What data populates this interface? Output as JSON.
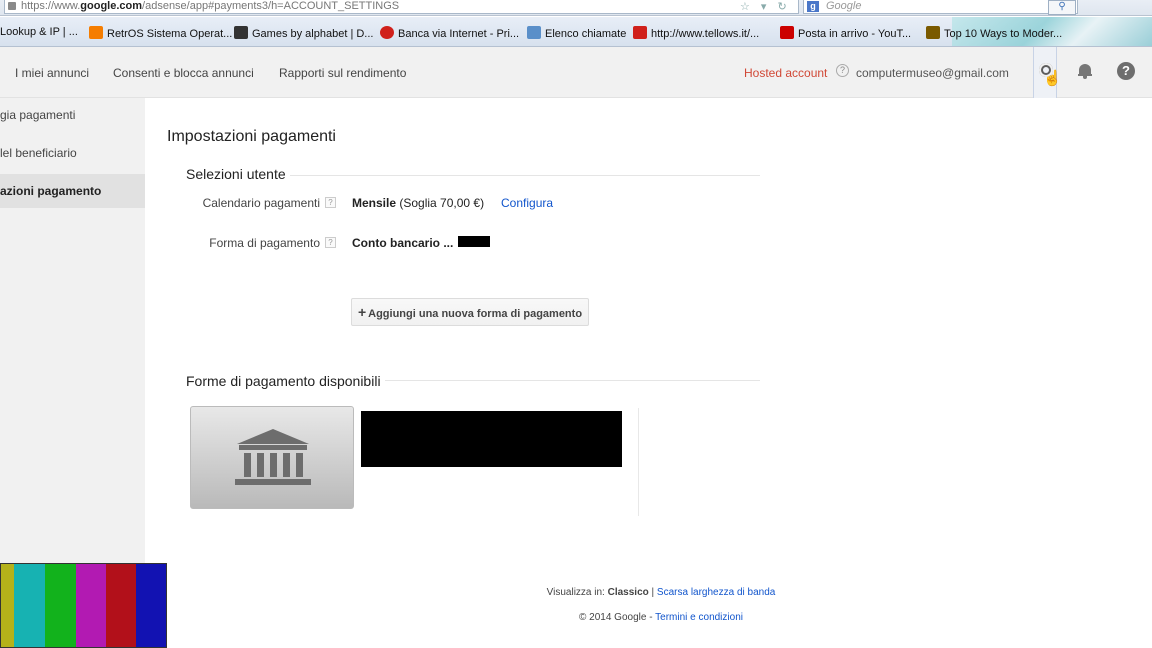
{
  "browser": {
    "url_prefix": "https://www.",
    "url_domain": "google.com",
    "url_path": "/adsense/app#payments3/h=ACCOUNT_SETTINGS",
    "search_placeholder": "Google",
    "bookmarks": [
      {
        "label": "Lookup & IP | ...",
        "color": "#888888"
      },
      {
        "label": "RetrOS Sistema Operat...",
        "color": "#f57d00"
      },
      {
        "label": "Games by alphabet | D...",
        "color": "#333333"
      },
      {
        "label": "Banca via Internet - Pri...",
        "color": "#d0201b"
      },
      {
        "label": "Elenco chiamate",
        "color": "#5a8fc9"
      },
      {
        "label": "http://www.tellows.it/...",
        "color": "#d0201b"
      },
      {
        "label": "Posta in arrivo - YouT...",
        "color": "#cc0000"
      },
      {
        "label": "Top 10 Ways to Moder...",
        "color": "#7a5a00"
      }
    ]
  },
  "header": {
    "nav": [
      "I miei annunci",
      "Consenti e blocca annunci",
      "Rapporti sul rendimento"
    ],
    "hosted_account": "Hosted account",
    "email": "computermuseo@gmail.com"
  },
  "sidebar": {
    "items": [
      {
        "label": "gia pagamenti",
        "active": false
      },
      {
        "label": "lel beneficiario",
        "active": false
      },
      {
        "label": "azioni pagamento",
        "active": true
      }
    ]
  },
  "main": {
    "title": "Impostazioni pagamenti",
    "user_section": "Selezioni utente",
    "schedule_label": "Calendario pagamenti",
    "schedule_value": "Mensile",
    "schedule_threshold": "(Soglia 70,00 €)",
    "configure_link": "Configura",
    "method_label": "Forma di pagamento",
    "method_value": "Conto bancario ...",
    "add_button": "Aggiungi una nuova forma di pagamento",
    "available_section": "Forme di pagamento disponibili"
  },
  "footer": {
    "view_in": "Visualizza in:",
    "classic": "Classico",
    "low_bandwidth": "Scarsa larghezza di banda",
    "copyright": "© 2014 Google",
    "terms": "Termini e condizioni"
  },
  "colors": {
    "accent_link": "#1155cc",
    "hosted_red": "#d14836",
    "test_bars": [
      "#b5b21a",
      "#17b2b2",
      "#12b21c",
      "#b21ab2",
      "#b2101a",
      "#1212b2"
    ]
  }
}
